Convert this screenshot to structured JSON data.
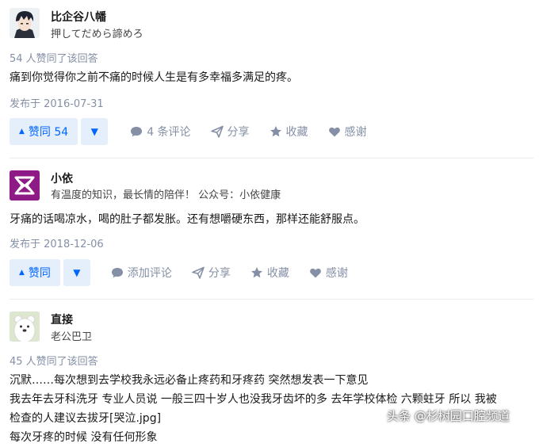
{
  "answers": [
    {
      "author": {
        "name": "比企谷八幡",
        "bio": "押してだめら諦めろ",
        "avatar": "anime-boy-avatar"
      },
      "votes_text": "54 人赞同了该回答",
      "content": [
        "痛到你觉得你之前不痛的时候人生是有多幸福多满足的疼。"
      ],
      "date": "发布于 2016-07-31",
      "actions": {
        "upvote": "赞同 54",
        "comment": "4 条评论",
        "share": "分享",
        "collect": "收藏",
        "thanks": "感谢"
      }
    },
    {
      "author": {
        "name": "小依",
        "bio": "有温度的知识，最长情的陪伴！ 公众号：小依健康",
        "avatar": "purple-logo-avatar"
      },
      "votes_text": "",
      "content": [
        "牙痛的话喝凉水，喝的肚子都发胀。还有想嚼硬东西，那样还能舒服点。"
      ],
      "date": "发布于 2018-12-06",
      "actions": {
        "upvote": "赞同",
        "comment": "添加评论",
        "share": "分享",
        "collect": "收藏",
        "thanks": "感谢"
      }
    },
    {
      "author": {
        "name": "直接",
        "bio": "老公巴卫",
        "avatar": "bear-avatar"
      },
      "votes_text": "45 人赞同了该回答",
      "content": [
        "沉默……每次想到去学校我永远必备止疼药和牙疼药 突然想发表一下意见",
        "我去年去牙科洗牙 专业人员说 一般三四十岁人也没我牙齿坏的多 去年学校体检 六颗蛀牙 所以 我被",
        "检查的人建议去拔牙[哭泣.jpg]",
        "每次牙疼的时候 没有任何形象"
      ]
    }
  ],
  "watermark": "头条 @杉树园口腔频道",
  "colors": {
    "accent": "#0066ff",
    "vote_bg": "#e5effc",
    "meta": "#8590a6",
    "logo_purple": "#8e1a86"
  }
}
